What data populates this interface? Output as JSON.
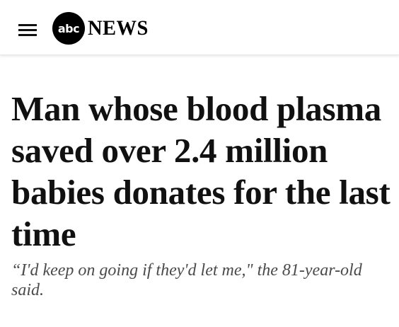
{
  "header": {
    "logo_badge_text": "abc",
    "logo_news_text": "NEWS",
    "menu_icon": "hamburger-menu-icon"
  },
  "article": {
    "headline": "Man whose blood plasma saved over 2.4 million babies donates for the last time",
    "subheadline": "“I'd keep on going if they'd let me,\" the 81-year-old said."
  },
  "colors": {
    "text": "#111111",
    "subtext": "#4a4a4a",
    "logo_badge": "#000000"
  }
}
